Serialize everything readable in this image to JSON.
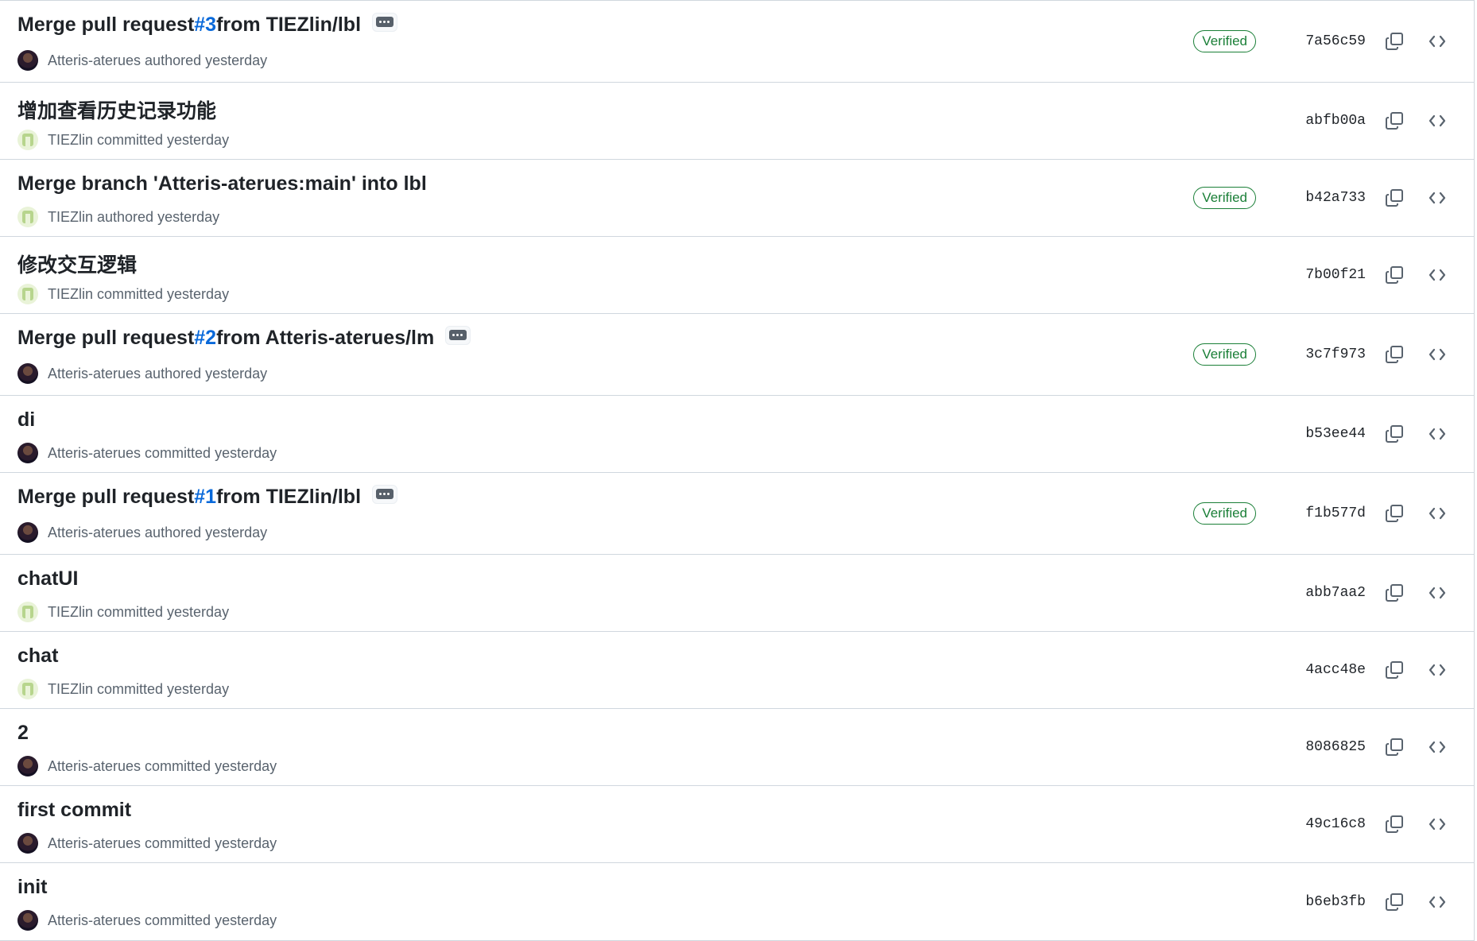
{
  "commits": [
    {
      "title_prefix": "Merge pull request ",
      "pr": "#3",
      "title_suffix": " from TIEZlin/lbl",
      "has_ellipsis": true,
      "avatar": "dark",
      "author_text": "Atteris-aterues authored yesterday",
      "verified": "Verified",
      "sha": "7a56c59"
    },
    {
      "title_prefix": "增加查看历史记录功能",
      "pr": "",
      "title_suffix": "",
      "has_ellipsis": false,
      "avatar": "light",
      "author_text": "TIEZlin committed yesterday",
      "verified": "",
      "sha": "abfb00a"
    },
    {
      "title_prefix": "Merge branch 'Atteris-aterues:main' into lbl",
      "pr": "",
      "title_suffix": "",
      "has_ellipsis": false,
      "avatar": "light",
      "author_text": "TIEZlin authored yesterday",
      "verified": "Verified",
      "sha": "b42a733"
    },
    {
      "title_prefix": "修改交互逻辑",
      "pr": "",
      "title_suffix": "",
      "has_ellipsis": false,
      "avatar": "light",
      "author_text": "TIEZlin committed yesterday",
      "verified": "",
      "sha": "7b00f21"
    },
    {
      "title_prefix": "Merge pull request ",
      "pr": "#2",
      "title_suffix": " from Atteris-aterues/lm",
      "has_ellipsis": true,
      "avatar": "dark",
      "author_text": "Atteris-aterues authored yesterday",
      "verified": "Verified",
      "sha": "3c7f973"
    },
    {
      "title_prefix": "di",
      "pr": "",
      "title_suffix": "",
      "has_ellipsis": false,
      "avatar": "dark",
      "author_text": "Atteris-aterues committed yesterday",
      "verified": "",
      "sha": "b53ee44"
    },
    {
      "title_prefix": "Merge pull request ",
      "pr": "#1",
      "title_suffix": " from TIEZlin/lbl",
      "has_ellipsis": true,
      "avatar": "dark",
      "author_text": "Atteris-aterues authored yesterday",
      "verified": "Verified",
      "sha": "f1b577d"
    },
    {
      "title_prefix": "chatUI",
      "pr": "",
      "title_suffix": "",
      "has_ellipsis": false,
      "avatar": "light",
      "author_text": "TIEZlin committed yesterday",
      "verified": "",
      "sha": "abb7aa2"
    },
    {
      "title_prefix": "chat",
      "pr": "",
      "title_suffix": "",
      "has_ellipsis": false,
      "avatar": "light",
      "author_text": "TIEZlin committed yesterday",
      "verified": "",
      "sha": "4acc48e"
    },
    {
      "title_prefix": "2",
      "pr": "",
      "title_suffix": "",
      "has_ellipsis": false,
      "avatar": "dark",
      "author_text": "Atteris-aterues committed yesterday",
      "verified": "",
      "sha": "8086825"
    },
    {
      "title_prefix": "first commit",
      "pr": "",
      "title_suffix": "",
      "has_ellipsis": false,
      "avatar": "dark",
      "author_text": "Atteris-aterues committed yesterday",
      "verified": "",
      "sha": "49c16c8"
    },
    {
      "title_prefix": "init",
      "pr": "",
      "title_suffix": "",
      "has_ellipsis": false,
      "avatar": "dark",
      "author_text": "Atteris-aterues committed yesterday",
      "verified": "",
      "sha": "b6eb3fb"
    }
  ],
  "icons": {
    "copy": "copy-icon",
    "browse": "code-icon",
    "ellipsis": "ellipsis-icon"
  },
  "colors": {
    "verified": "#1a7f37",
    "link": "#0969da",
    "muted": "#59636e",
    "border": "#d0d7de"
  }
}
